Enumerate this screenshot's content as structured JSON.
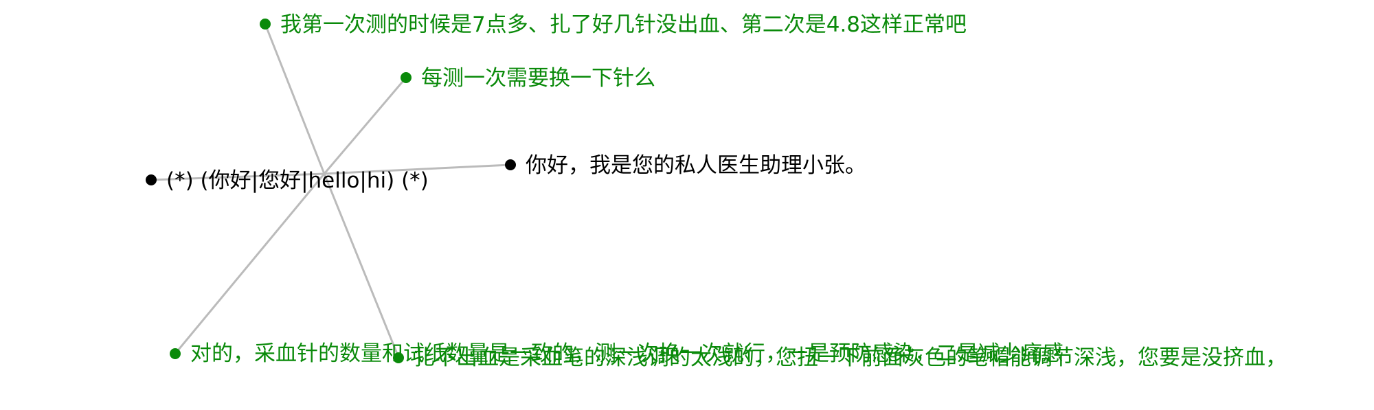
{
  "colors": {
    "center": "#000000",
    "response": "#000000",
    "question": "#0a8a0a",
    "answer": "#0a8a0a",
    "edge": "#bbbbbb"
  },
  "center_node": {
    "label": "(*) (你好|您好|hello|hi) (*)",
    "color": "#000000"
  },
  "linked_nodes": [
    {
      "id": "greeting-reply",
      "label": "你好，我是您的私人医生助理小张。",
      "color": "#000000"
    },
    {
      "id": "question-readings",
      "label": "我第一次测的时候是7点多、扎了好几针没出血、第二次是4.8这样正常吧",
      "color": "#0a8a0a"
    },
    {
      "id": "question-needle",
      "label": "每测一次需要换一下针么",
      "color": "#0a8a0a"
    },
    {
      "id": "answer-needle",
      "label": "对的，采血针的数量和试纸数量是一致的，测一次换一次就行，一是预防感染，二是减少痛感",
      "color": "#0a8a0a"
    },
    {
      "id": "answer-depth",
      "label": "扎不出血是采血笔的深浅调的太浅的，您扭一下前面灰色的笔帽能调节深浅，您要是没挤血，",
      "color": "#0a8a0a"
    }
  ]
}
